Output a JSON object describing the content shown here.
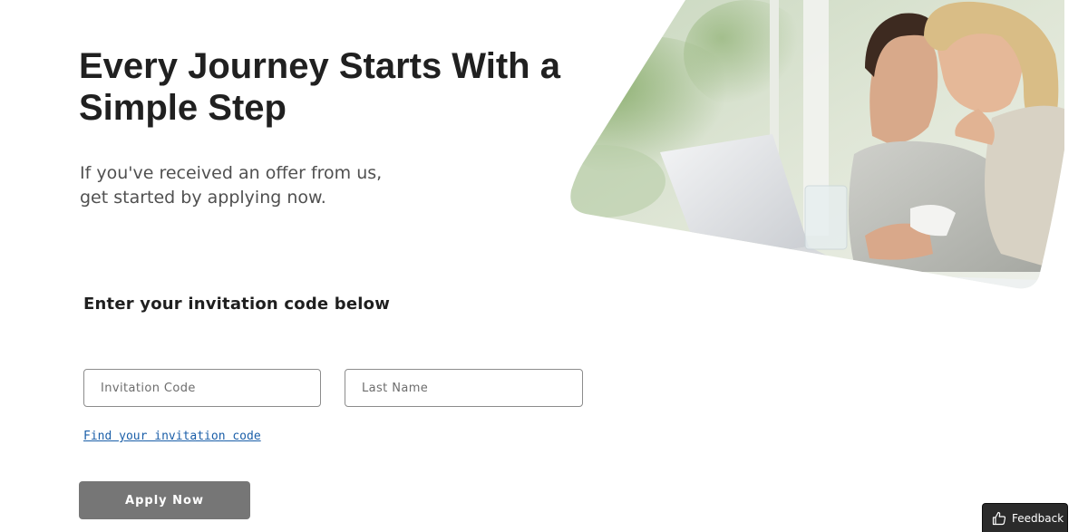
{
  "hero": {
    "headline": "Every Journey Starts With a Simple Step",
    "subtitle": "If you've received an offer from us, get started by applying now."
  },
  "invitation": {
    "heading": "Enter your invitation code below",
    "code_placeholder": "Invitation Code",
    "code_value": "",
    "last_name_placeholder": "Last Name",
    "last_name_value": "",
    "find_link": "Find your invitation code",
    "apply_label": "Apply Now"
  },
  "feedback": {
    "label": "Feedback",
    "icon": "thumbs-up-icon"
  },
  "colors": {
    "link": "#1a5ea8",
    "button_bg": "#767676",
    "heading_text": "#202020",
    "feedback_bg": "#2b2b2b"
  }
}
